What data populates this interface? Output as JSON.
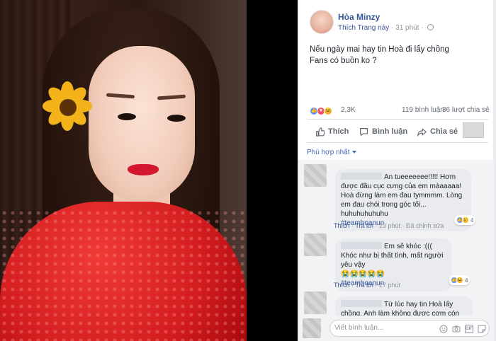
{
  "post": {
    "author": "Hòa Minzy",
    "like_page": "Thích Trang này",
    "time": "31 phút",
    "text_lines": [
      "Nếu ngày mai hay tin Hoà đi lấy chồng",
      "Fans có buồn ko ?"
    ],
    "reaction_count": "2,3K",
    "comment_count": "119 bình luận",
    "share_count": "36 lượt chia sẻ"
  },
  "actions": {
    "like": "Thích",
    "comment": "Bình luận",
    "share": "Chia sẻ"
  },
  "sort_label": "Phù hợp nhất",
  "comments": [
    {
      "text": "An tueeeeeee!!!!! Hơm được đâu cục cưng của em màaaaaa! Hoà đừng làm em đau tymmmm. Lòng em đau chói trong góc tối... huhuhuhuhuhu",
      "hashtag": "#teamhoanun",
      "like": "Thích",
      "reply": "Trả lời",
      "time": "23 phút",
      "edited": "Đã chỉnh sửa",
      "reactions": "4"
    },
    {
      "text": "Em sẽ khóc :((( Khóc như bị thất tình, mất người yêu vậy",
      "emojis": "😭😭😭😭😭",
      "hashtag": "#teamhoanun",
      "like": "Thích",
      "reply": "Trả lời",
      "time": "27 phút",
      "reactions": "4"
    },
    {
      "text": "Từ lúc hay tin Hoà lấy chồng. Anh làm không được cơm còn"
    }
  ],
  "compose": {
    "placeholder": "Viết bình luận..."
  },
  "colors": {
    "link": "#385898",
    "muted": "#90949c",
    "accent_blue": "#4267b2"
  },
  "icons": [
    "globe-icon",
    "like-reaction-icon",
    "love-reaction-icon",
    "haha-reaction-icon",
    "thumb-up-icon",
    "comment-icon",
    "share-icon",
    "emoji-icon",
    "camera-icon",
    "gif-icon",
    "sticker-icon"
  ]
}
